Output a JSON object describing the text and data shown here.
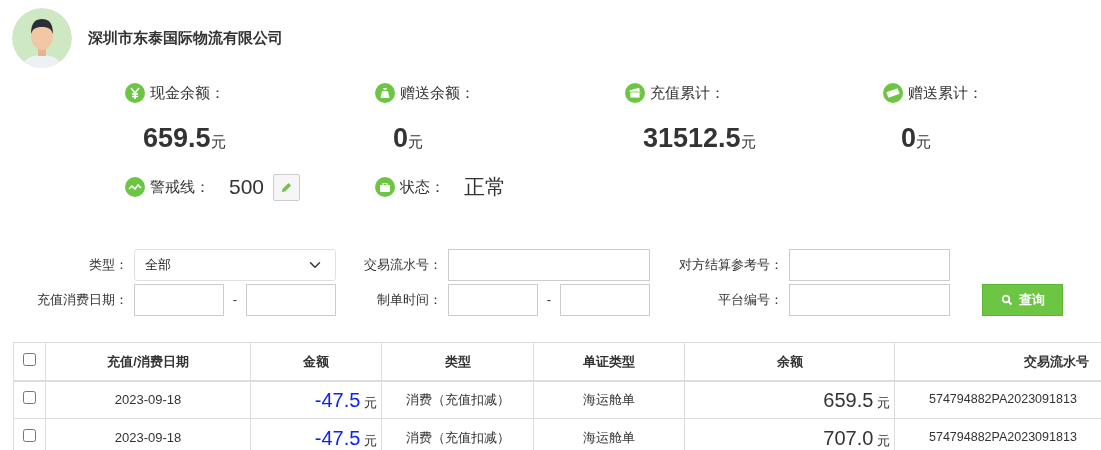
{
  "company": {
    "name": "深圳市东泰国际物流有限公司"
  },
  "stats": [
    {
      "kind": "yen",
      "label": "现金余额：",
      "value": "659.5",
      "unit": "元"
    },
    {
      "kind": "bag",
      "label": "赠送余额：",
      "value": "0",
      "unit": "元"
    },
    {
      "kind": "cash",
      "label": "充值累计：",
      "value": "31512.5",
      "unit": "元"
    },
    {
      "kind": "note",
      "label": "赠送累计：",
      "value": "0",
      "unit": "元"
    }
  ],
  "alert_line": {
    "label": "警戒线：",
    "value": "500"
  },
  "status": {
    "label": "状态：",
    "value": "正常"
  },
  "filters": [
    {
      "kind": "select",
      "label": "类型：",
      "value": "全部"
    },
    {
      "kind": "text",
      "label": "交易流水号："
    },
    {
      "kind": "text",
      "label": "对方结算参考号："
    },
    {
      "kind": "range",
      "label": "充值消费日期：",
      "separator": "-"
    },
    {
      "kind": "range",
      "label": "制单时间：",
      "separator": "-"
    },
    {
      "kind": "text",
      "label": "平台编号："
    }
  ],
  "search_button": {
    "label": "查询"
  },
  "table": {
    "header_checked": false,
    "columns": [
      "充值/消费日期",
      "金额",
      "类型",
      "单证类型",
      "余额",
      "交易流水号"
    ],
    "rows": [
      {
        "checked": false,
        "date": "2023-09-18",
        "amount": "-47.5",
        "amount_unit": "元",
        "type": "消费（充值扣减）",
        "doc_type": "海运舱单",
        "balance": "659.5",
        "balance_unit": "元",
        "txn_no": "574794882PA2023091813"
      },
      {
        "checked": false,
        "date": "2023-09-18",
        "amount": "-47.5",
        "amount_unit": "元",
        "type": "消费（充值扣减）",
        "doc_type": "海运舱单",
        "balance": "707.0",
        "balance_unit": "元",
        "txn_no": "574794882PA2023091813"
      }
    ]
  }
}
